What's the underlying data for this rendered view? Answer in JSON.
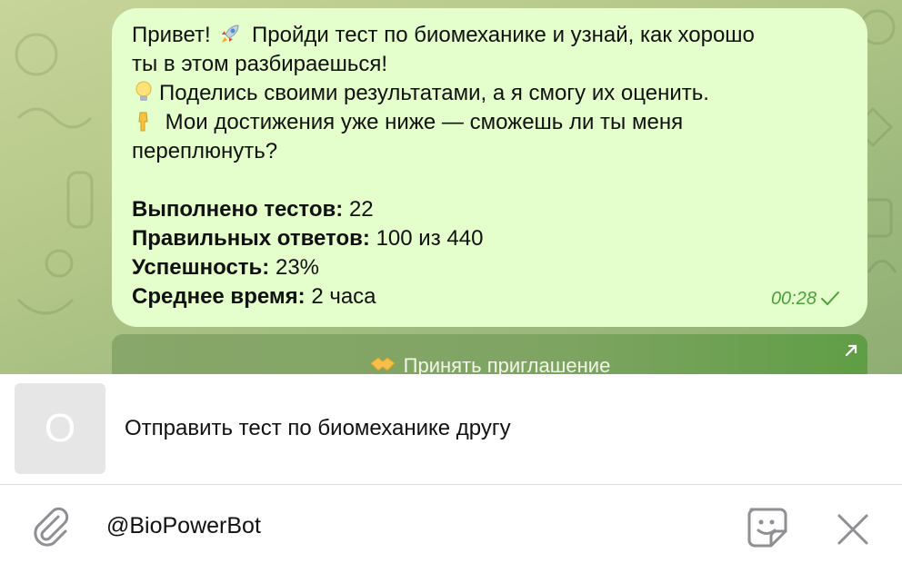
{
  "message": {
    "line1_a": "Привет!",
    "line1_b": "Пройди тест по биомеханике и узнай, как хорошо",
    "line2": "ты в этом разбираешься!",
    "line3": "Поделись своими результатами, а я смогу их оценить.",
    "line4": "Мои достижения уже ниже — сможешь ли ты меня",
    "line5": "переплюнуть?",
    "stats": [
      {
        "label": "Выполнено тестов:",
        "value": "22"
      },
      {
        "label": "Правильных ответов:",
        "value": "100 из 440"
      },
      {
        "label": "Успешность:",
        "value": "23%"
      },
      {
        "label": "Среднее время:",
        "value": "2 часа"
      }
    ],
    "time": "00:28",
    "emoji": [
      "rocket",
      "light-bulb",
      "pointing-down-hand"
    ]
  },
  "inline_button": {
    "label": "Принять приглашение",
    "emoji": "handshake"
  },
  "inline_result": {
    "thumb_letter": "О",
    "title": "Отправить тест по биомеханике другу"
  },
  "input": {
    "value": "@BioPowerBot"
  },
  "colors": {
    "bubble": "#e4ffcb",
    "time": "#4aa13b",
    "button": "#7ea462",
    "icon": "#8e8e93"
  },
  "icons": [
    "paperclip-icon",
    "sticker-icon",
    "close-icon",
    "check-icon",
    "arrow-out-icon"
  ]
}
